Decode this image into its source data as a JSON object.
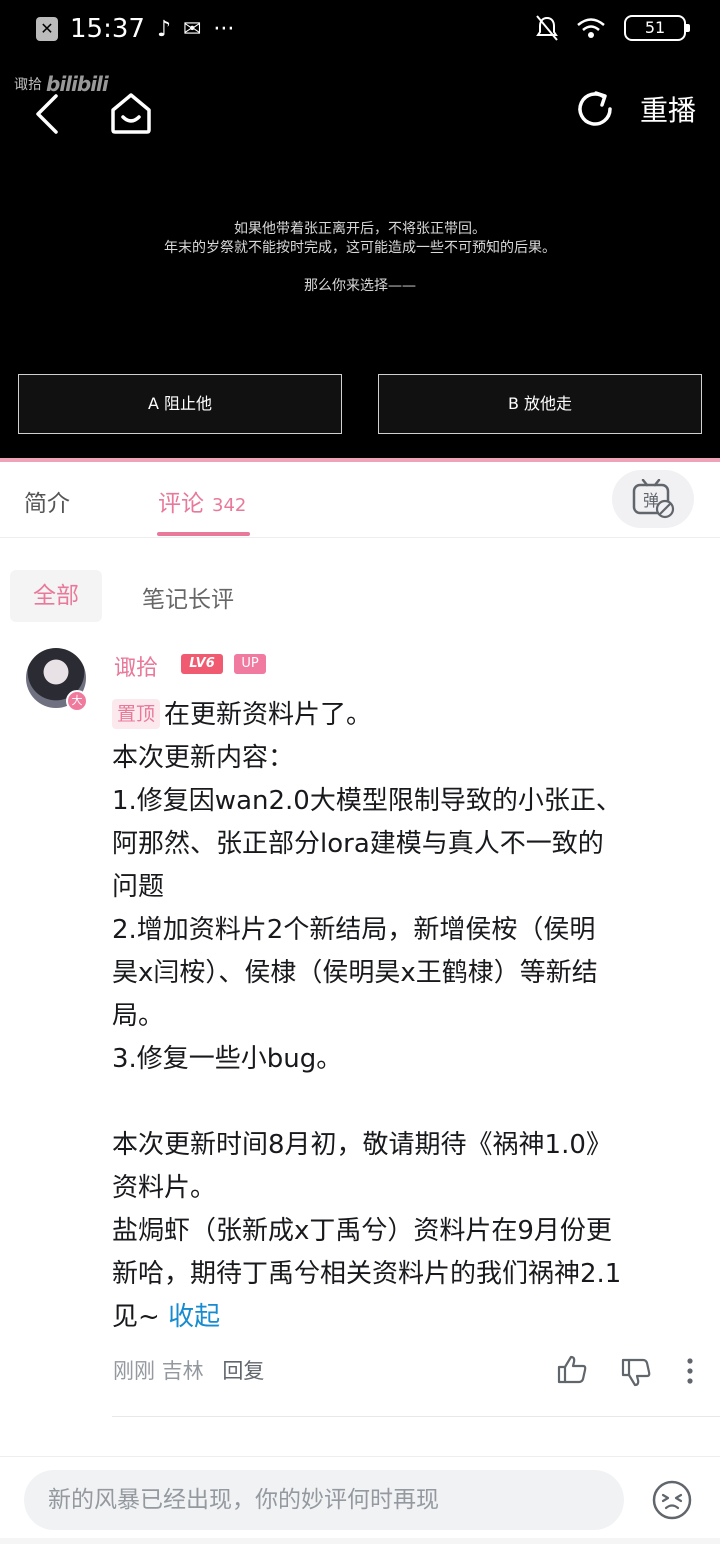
{
  "status_bar": {
    "time": "15:37",
    "battery": "51"
  },
  "player": {
    "watermark_user": "诹拾",
    "watermark_logo": "bilibili",
    "replay_label": "重播",
    "story_line1": "如果他带着张正离开后，不将张正带回。",
    "story_line2": "年末的岁祭就不能按时完成，这可能造成一些不可预知的后果。",
    "story_prompt": "那么你来选择——",
    "choice_a": "A 阻止他",
    "choice_b": "B 放他走"
  },
  "tabs": {
    "intro": "简介",
    "comments": "评论",
    "comments_count": "342"
  },
  "filter": {
    "all": "全部",
    "notes": "笔记长评"
  },
  "comment": {
    "username": "诹拾",
    "level": "LV6",
    "up_badge": "UP",
    "avatar_badge": "大",
    "pin_label": "置顶",
    "lines": [
      "在更新资料片了。",
      "本次更新内容：",
      "1.修复因wan2.0大模型限制导致的小张正、",
      "阿那然、张正部分lora建模与真人不一致的",
      "问题",
      "2.增加资料片2个新结局，新增侯桉（侯明",
      "昊x闫桉）、侯棣（侯明昊x王鹤棣）等新结",
      "局。",
      "3.修复一些小bug。",
      "",
      "本次更新时间8月初，敬请期待《祸神1.0》",
      "资料片。",
      "盐焗虾（张新成x丁禹兮）资料片在9月份更",
      "新哈，期待丁禹兮相关资料片的我们祸神2.1",
      "见~ "
    ],
    "collapse": "收起",
    "time": "刚刚",
    "location": "吉林",
    "reply": "回复"
  },
  "input": {
    "placeholder": "新的风暴已经出现，你的妙评何时再现"
  },
  "colors": {
    "accent_pink": "#e8799a",
    "link_blue": "#178bcf"
  }
}
